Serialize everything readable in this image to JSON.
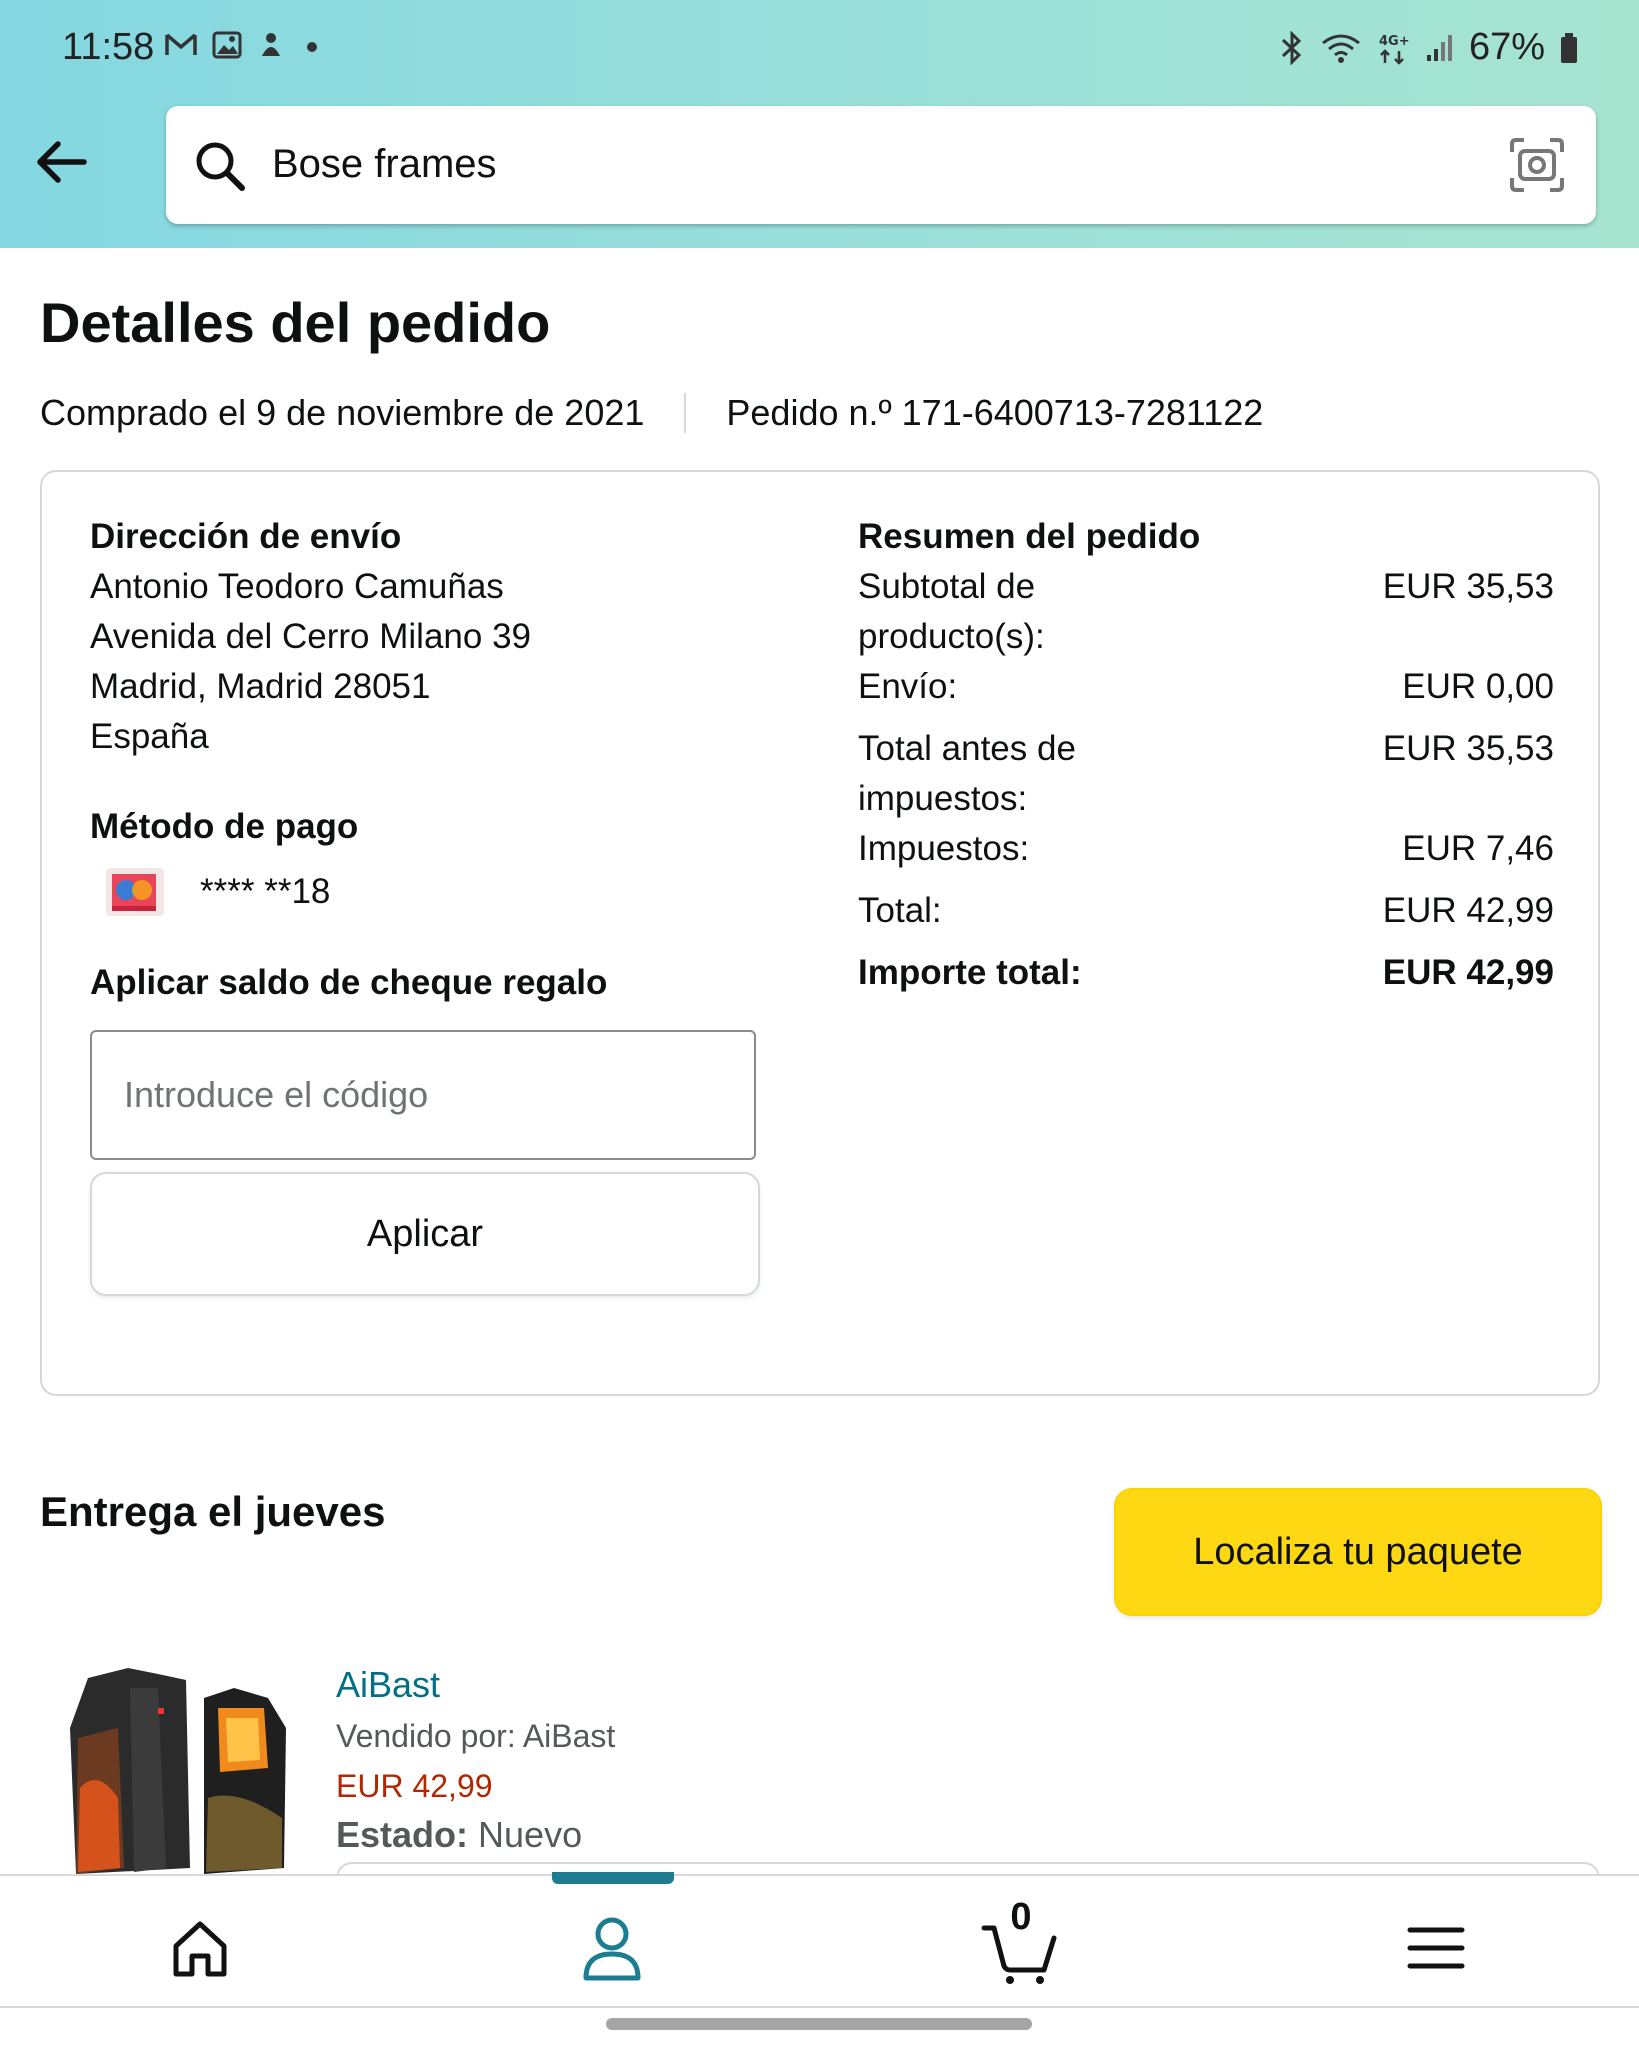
{
  "status_bar": {
    "time": "11:58",
    "battery": "67%",
    "icons_left": [
      "gmail-icon",
      "gallery-icon",
      "app-icon",
      "dot-icon"
    ],
    "icons_right": [
      "bluetooth-icon",
      "wifi-icon",
      "4g-icon",
      "signal-icon",
      "battery-icon"
    ]
  },
  "search": {
    "query": "Bose frames"
  },
  "page": {
    "title": "Detalles del pedido",
    "purchased": "Comprado el 9 de noviembre de 2021",
    "order_number": "Pedido n.º 171-6400713-7281122"
  },
  "shipping": {
    "heading": "Dirección de envío",
    "lines": [
      "Antonio Teodoro Camuñas",
      "Avenida del Cerro Milano 39",
      "Madrid, Madrid 28051",
      "España"
    ]
  },
  "payment": {
    "heading": "Método de pago",
    "card_masked": "**** **18"
  },
  "gift": {
    "heading": "Aplicar saldo de cheque regalo",
    "placeholder": "Introduce el código",
    "value": "",
    "apply_label": "Aplicar"
  },
  "summary": {
    "heading": "Resumen del pedido",
    "rows": [
      {
        "label": "Subtotal de producto(s):",
        "value": "EUR 35,53"
      },
      {
        "label": "Envío:",
        "value": "EUR 0,00"
      },
      {
        "label": "Total antes de impuestos:",
        "value": "EUR 35,53"
      },
      {
        "label": "Impuestos:",
        "value": "EUR 7,46"
      },
      {
        "label": "Total:",
        "value": "EUR 42,99"
      },
      {
        "label": "Importe total:",
        "value": "EUR 42,99"
      }
    ]
  },
  "delivery": {
    "heading": "Entrega el jueves",
    "track_label": "Localiza tu paquete"
  },
  "item": {
    "brand": "AiBast",
    "seller": "Vendido por: AiBast",
    "price": "EUR 42,99",
    "condition_label": "Estado:",
    "condition_value": "Nuevo"
  },
  "bottom_nav": {
    "items": [
      "home-icon",
      "account-icon",
      "cart-icon",
      "menu-icon"
    ],
    "cart_count": "0",
    "active": "account-icon"
  },
  "colors": {
    "header_gradient_start": "#84d7e1",
    "header_gradient_end": "#a6e4cf",
    "link": "#007185",
    "price": "#b12704",
    "primary_button": "#ffd814",
    "active_tab": "#1b7d8f"
  }
}
